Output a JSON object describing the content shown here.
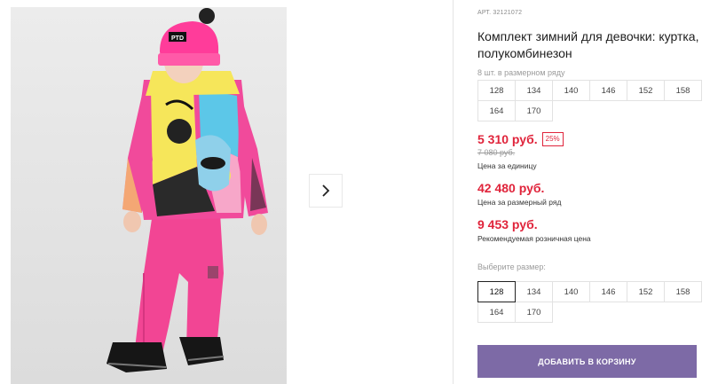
{
  "product": {
    "sku": "АРТ. 32121072",
    "title": "Комплект зимний для девочки: куртка, полукомбинезон",
    "pack_note": "8 шт. в размерном ряду",
    "pack_sizes": [
      "128",
      "134",
      "140",
      "146",
      "152",
      "158",
      "164",
      "170"
    ]
  },
  "prices": {
    "unit_price": "5 310 руб.",
    "discount_badge": "25%",
    "old_price": "7 080 руб.",
    "unit_caption": "Цена за единицу",
    "pack_price": "42 480 руб.",
    "pack_caption": "Цена за размерный ряд",
    "retail_price": "9 453 руб.",
    "retail_caption": "Рекомендуемая розничная цена"
  },
  "size_select": {
    "label": "Выберите размер:",
    "options": [
      "128",
      "134",
      "140",
      "146",
      "152",
      "158",
      "164",
      "170"
    ],
    "selected": "128"
  },
  "actions": {
    "add_to_cart": "ДОБАВИТЬ В КОРЗИНУ"
  },
  "gallery": {
    "hat_logo": "PTD",
    "next_icon": "chevron-right-icon"
  },
  "colors": {
    "price_red": "#e0243b",
    "button_purple": "#7d6aa6"
  }
}
